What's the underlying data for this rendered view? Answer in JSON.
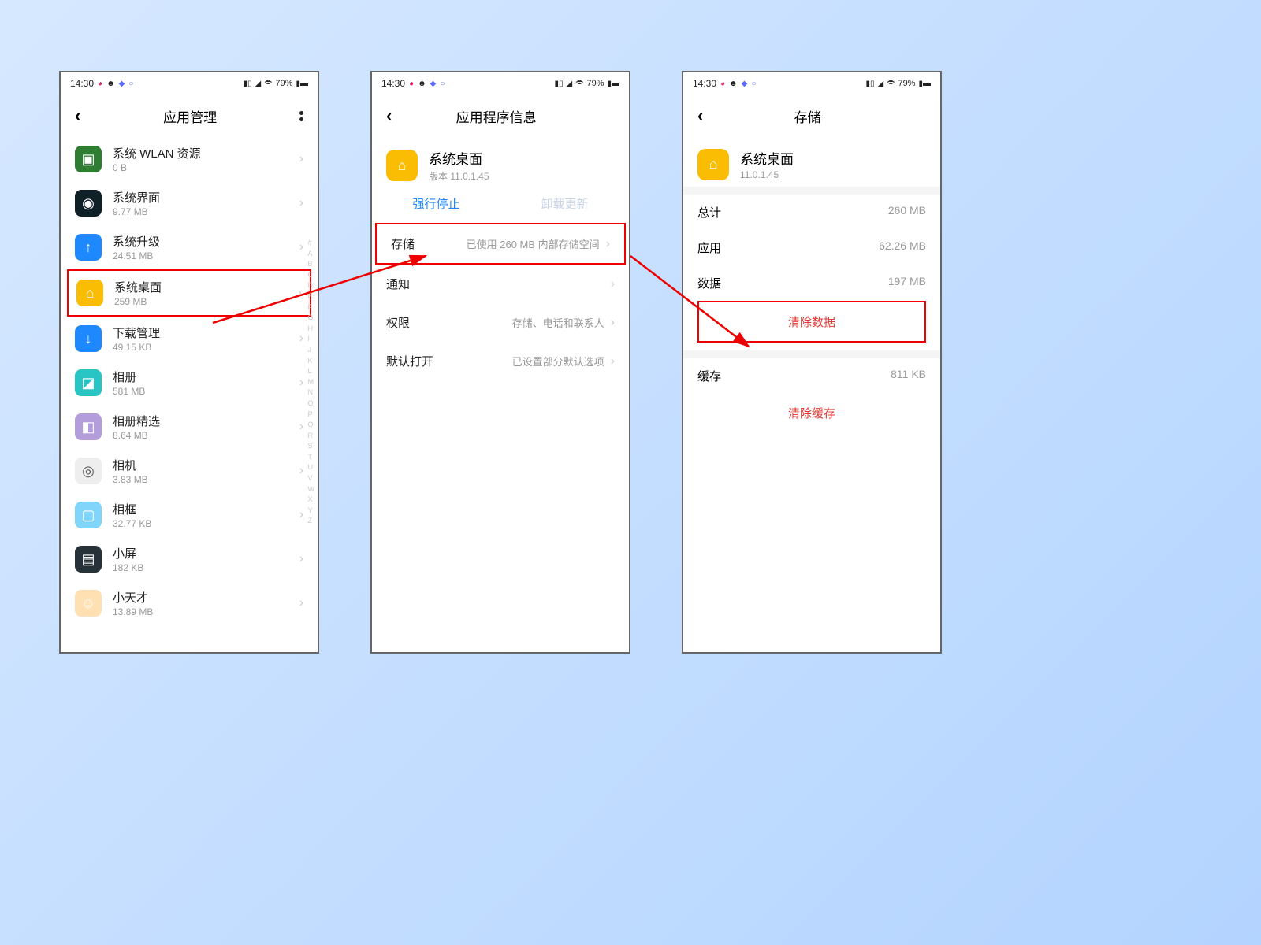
{
  "status": {
    "time": "14:30",
    "battery": "79%"
  },
  "index_letters": [
    "#",
    "A",
    "B",
    "C",
    "D",
    "E",
    "F",
    "G",
    "H",
    "I",
    "J",
    "K",
    "L",
    "M",
    "N",
    "O",
    "P",
    "Q",
    "R",
    "S",
    "T",
    "U",
    "V",
    "W",
    "X",
    "Y",
    "Z"
  ],
  "screen1": {
    "title": "应用管理",
    "apps": [
      {
        "name": "系统 WLAN 资源",
        "size": "0 B",
        "icon_bg": "#2e7d32",
        "glyph": "▣"
      },
      {
        "name": "系统界面",
        "size": "9.77 MB",
        "icon_bg": "#102027",
        "glyph": "◉"
      },
      {
        "name": "系统升级",
        "size": "24.51 MB",
        "icon_bg": "#1e88ff",
        "glyph": "↑"
      },
      {
        "name": "系统桌面",
        "size": "259 MB",
        "icon_bg": "#fbbc04",
        "glyph": "⌂",
        "highlight": true
      },
      {
        "name": "下载管理",
        "size": "49.15 KB",
        "icon_bg": "#1e88ff",
        "glyph": "↓"
      },
      {
        "name": "相册",
        "size": "581 MB",
        "icon_bg": "#29c4c4",
        "glyph": "◪"
      },
      {
        "name": "相册精选",
        "size": "8.64 MB",
        "icon_bg": "#b39ddb",
        "glyph": "◧"
      },
      {
        "name": "相机",
        "size": "3.83 MB",
        "icon_bg": "#eeeeee",
        "glyph": "◎"
      },
      {
        "name": "相框",
        "size": "32.77 KB",
        "icon_bg": "#81d4fa",
        "glyph": "▢"
      },
      {
        "name": "小屏",
        "size": "182 KB",
        "icon_bg": "#263238",
        "glyph": "▤"
      },
      {
        "name": "小天才",
        "size": "13.89 MB",
        "icon_bg": "#ffe0b2",
        "glyph": "☺"
      }
    ]
  },
  "screen2": {
    "title": "应用程序信息",
    "app_name": "系统桌面",
    "version_label": "版本 11.0.1.45",
    "force_stop": "强行停止",
    "uninstall_updates": "卸载更新",
    "rows": {
      "storage": {
        "label": "存储",
        "value": "已使用 260 MB 内部存储空间"
      },
      "notif": {
        "label": "通知",
        "value": ""
      },
      "perm": {
        "label": "权限",
        "value": "存储、电话和联系人"
      },
      "default": {
        "label": "默认打开",
        "value": "已设置部分默认选项"
      }
    }
  },
  "screen3": {
    "title": "存储",
    "app_name": "系统桌面",
    "version": "11.0.1.45",
    "total": {
      "label": "总计",
      "value": "260 MB"
    },
    "app": {
      "label": "应用",
      "value": "62.26 MB"
    },
    "data": {
      "label": "数据",
      "value": "197 MB"
    },
    "clear_data": "清除数据",
    "cache": {
      "label": "缓存",
      "value": "811 KB"
    },
    "clear_cache": "清除缓存"
  }
}
